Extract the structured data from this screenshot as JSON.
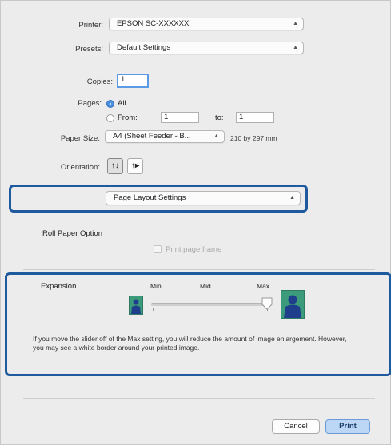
{
  "printer": {
    "label": "Printer:",
    "value": "EPSON SC-XXXXXX"
  },
  "presets": {
    "label": "Presets:",
    "value": "Default Settings"
  },
  "copies": {
    "label": "Copies:",
    "value": "1"
  },
  "pages": {
    "label": "Pages:",
    "all_label": "All",
    "from_label": "From:",
    "from_value": "1",
    "to_label": "to:",
    "to_value": "1"
  },
  "paper_size": {
    "label": "Paper Size:",
    "value": "A4 (Sheet Feeder - B...",
    "dims": "210 by 297 mm"
  },
  "orientation": {
    "label": "Orientation:"
  },
  "section_popup": {
    "value": "Page Layout Settings"
  },
  "roll_paper": {
    "label": "Roll Paper Option",
    "checkbox_label": "Print page frame"
  },
  "expansion": {
    "label": "Expansion",
    "min_label": "Min",
    "mid_label": "Mid",
    "max_label": "Max",
    "slider_level": "max",
    "description": "If you move the slider off of the Max setting, you will reduce the amount of image enlargement. However, you may see a white border around your printed image."
  },
  "buttons": {
    "cancel": "Cancel",
    "print": "Print"
  },
  "colors": {
    "highlight": "#1f5a9e",
    "accent": "#4a8fe0",
    "icon_bg": "#3b9b7a"
  }
}
